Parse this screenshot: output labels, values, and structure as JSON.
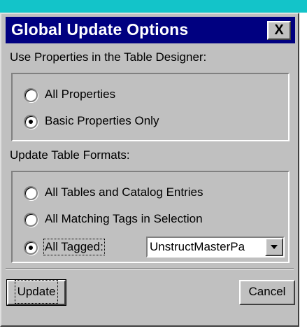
{
  "window": {
    "title": "Global Update Options",
    "close_glyph": "X"
  },
  "properties_section": {
    "label": "Use Properties in the Table Designer:",
    "options": [
      {
        "label": "All Properties",
        "checked": false
      },
      {
        "label": "Basic Properties Only",
        "checked": true
      }
    ]
  },
  "formats_section": {
    "label": "Update Table Formats:",
    "options": [
      {
        "label": "All Tables and Catalog Entries",
        "checked": false
      },
      {
        "label": "All Matching Tags in Selection",
        "checked": false
      },
      {
        "label": "All Tagged:",
        "checked": true
      }
    ],
    "tag_select": {
      "value": "UnstructMasterPa"
    }
  },
  "buttons": {
    "update_label": "Update",
    "cancel_label": "Cancel"
  },
  "colors": {
    "title_bar": "#000080",
    "dialog_bg": "#c0c0c0",
    "top_band": "#13c4c9"
  }
}
